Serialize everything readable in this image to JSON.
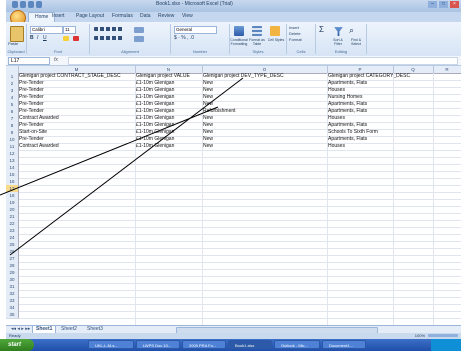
{
  "window": {
    "title": "Book1.xlsx - Microsoft Excel (Trial)"
  },
  "ribbon": {
    "tabs": [
      "Home",
      "Insert",
      "Page Layout",
      "Formulas",
      "Data",
      "Review",
      "View"
    ],
    "font_name": "Calibri",
    "font_size": "11",
    "number_format": "General",
    "groups": [
      "Clipboard",
      "Font",
      "Alignment",
      "Number",
      "Styles",
      "Cells",
      "Editing"
    ],
    "styles_buttons": [
      "Conditional Formatting",
      "Format as Table",
      "Cell Styles"
    ],
    "cells_buttons": [
      "Insert",
      "Delete",
      "Format"
    ],
    "editing_buttons": [
      "Sort & Filter",
      "Find & Select"
    ],
    "paste_label": "Paste"
  },
  "formula_bar": {
    "name_box": "L17",
    "fx": "fx",
    "value": ""
  },
  "grid": {
    "columns": [
      "M",
      "N",
      "O",
      "P",
      "Q",
      "R"
    ],
    "row_numbers": [
      "1",
      "2",
      "3",
      "4",
      "5",
      "6",
      "7",
      "8",
      "9",
      "10",
      "11",
      "12",
      "13",
      "14",
      "15",
      "16",
      "17",
      "18",
      "19",
      "20",
      "21",
      "22",
      "23",
      "24",
      "25",
      "26",
      "27",
      "28",
      "29",
      "30",
      "31",
      "32",
      "33",
      "34",
      "35"
    ],
    "selected_row": "17",
    "rows": [
      [
        "Glenigan project CONTRACT_STAGE_DESC",
        "Glenigan project VALUE",
        "Glenigan project DEV_TYPE_DESC",
        "Glenigan project CATEGORY_DESC"
      ],
      [
        "Pre-Tender",
        "£1-10m Glenigan",
        "New",
        "Apartments, Flats"
      ],
      [
        "Pre-Tender",
        "£1-10m Glenigan",
        "New",
        "Houses"
      ],
      [
        "Pre-Tender",
        "£1-10m Glenigan",
        "New",
        "Nursing Homes"
      ],
      [
        "Pre-Tender",
        "£1-10m Glenigan",
        "New",
        "Apartments, Flats"
      ],
      [
        "Pre-Tender",
        "£1-10m Glenigan",
        "Refurbishment",
        "Apartments, Flats"
      ],
      [
        "Contract Awarded",
        "£1-10m Glenigan",
        "New",
        "Houses"
      ],
      [
        "Pre-Tender",
        "£1-10m Glenigan",
        "New",
        "Apartments, Flats"
      ],
      [
        "Start-on-Site",
        "£1-10m Glenigan",
        "New",
        "Schools To Sixth Form"
      ],
      [
        "Pre-Tender",
        "£1-10m Glenigan",
        "New",
        "Apartments, Flats"
      ],
      [
        "Contract Awarded",
        "£1-10m Glenigan",
        "New",
        "Houses"
      ]
    ]
  },
  "sheets": [
    "Sheet1",
    "Sheet2",
    "Sheet3"
  ],
  "status": {
    "left": "Ready",
    "zoom": "100%"
  },
  "taskbar": {
    "start": "start",
    "items": [
      "UKL-L-M-s...",
      "LWPS Doc 10...",
      "2009 PRA Fo...",
      "Book1.xlsx",
      "Outlook - Mic...",
      "Document1..."
    ],
    "clock": ""
  }
}
